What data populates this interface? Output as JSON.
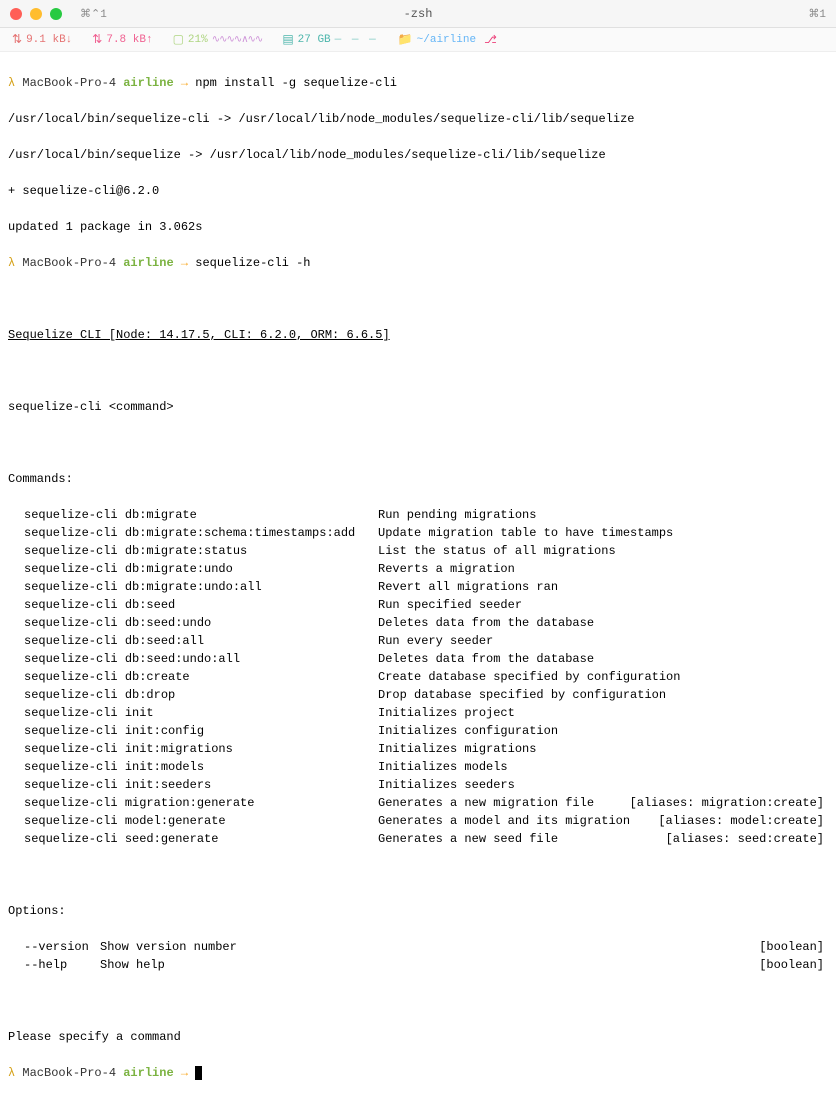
{
  "titlebar": {
    "tab_indicator": "⌘⌃1",
    "title": "-zsh",
    "pane_indicator": "⌘1"
  },
  "status": {
    "net_down": "9.1 kB↓",
    "net_up": "7.8 kB↑",
    "battery": "21%",
    "sparkline": "∿∿∿∿∧∿∿",
    "disk": "27 GB",
    "disk_spark": "— — —",
    "folder": "~/airline",
    "git_icon": "⎇"
  },
  "prompts": [
    {
      "lambda": "λ",
      "host": "MacBook-Pro-4",
      "dir": "airline",
      "arrow": "→",
      "cmd": "npm install -g sequelize-cli"
    }
  ],
  "install_output": [
    "/usr/local/bin/sequelize-cli -> /usr/local/lib/node_modules/sequelize-cli/lib/sequelize",
    "/usr/local/bin/sequelize -> /usr/local/lib/node_modules/sequelize-cli/lib/sequelize",
    "+ sequelize-cli@6.2.0",
    "updated 1 package in 3.062s"
  ],
  "prompt2": {
    "lambda": "λ",
    "host": "MacBook-Pro-4",
    "dir": "airline",
    "arrow": "→",
    "cmd": "sequelize-cli -h"
  },
  "cli_header": "Sequelize CLI [Node: 14.17.5, CLI: 6.2.0, ORM: 6.6.5]",
  "usage": "sequelize-cli <command>",
  "commands_label": "Commands:",
  "commands": [
    {
      "name": "sequelize-cli db:migrate",
      "desc": "Run pending migrations",
      "alias": ""
    },
    {
      "name": "sequelize-cli db:migrate:schema:timestamps:add",
      "desc": "Update migration table to have timestamps",
      "alias": ""
    },
    {
      "name": "sequelize-cli db:migrate:status",
      "desc": "List the status of all migrations",
      "alias": ""
    },
    {
      "name": "sequelize-cli db:migrate:undo",
      "desc": "Reverts a migration",
      "alias": ""
    },
    {
      "name": "sequelize-cli db:migrate:undo:all",
      "desc": "Revert all migrations ran",
      "alias": ""
    },
    {
      "name": "sequelize-cli db:seed",
      "desc": "Run specified seeder",
      "alias": ""
    },
    {
      "name": "sequelize-cli db:seed:undo",
      "desc": "Deletes data from the database",
      "alias": ""
    },
    {
      "name": "sequelize-cli db:seed:all",
      "desc": "Run every seeder",
      "alias": ""
    },
    {
      "name": "sequelize-cli db:seed:undo:all",
      "desc": "Deletes data from the database",
      "alias": ""
    },
    {
      "name": "sequelize-cli db:create",
      "desc": "Create database specified by configuration",
      "alias": ""
    },
    {
      "name": "sequelize-cli db:drop",
      "desc": "Drop database specified by configuration",
      "alias": ""
    },
    {
      "name": "sequelize-cli init",
      "desc": "Initializes project",
      "alias": ""
    },
    {
      "name": "sequelize-cli init:config",
      "desc": "Initializes configuration",
      "alias": ""
    },
    {
      "name": "sequelize-cli init:migrations",
      "desc": "Initializes migrations",
      "alias": ""
    },
    {
      "name": "sequelize-cli init:models",
      "desc": "Initializes models",
      "alias": ""
    },
    {
      "name": "sequelize-cli init:seeders",
      "desc": "Initializes seeders",
      "alias": ""
    },
    {
      "name": "sequelize-cli migration:generate",
      "desc": "Generates a new migration file",
      "alias": "[aliases: migration:create]"
    },
    {
      "name": "sequelize-cli model:generate",
      "desc": "Generates a model and its migration",
      "alias": "[aliases: model:create]"
    },
    {
      "name": "sequelize-cli seed:generate",
      "desc": "Generates a new seed file",
      "alias": "[aliases: seed:create]"
    }
  ],
  "options_label": "Options:",
  "options": [
    {
      "name": "--version",
      "desc": "Show version number",
      "type": "[boolean]"
    },
    {
      "name": "--help",
      "desc": "Show help",
      "type": "[boolean]"
    }
  ],
  "footer": "Please specify a command",
  "prompt3": {
    "lambda": "λ",
    "host": "MacBook-Pro-4",
    "dir": "airline",
    "arrow": "→",
    "cmd": ""
  }
}
